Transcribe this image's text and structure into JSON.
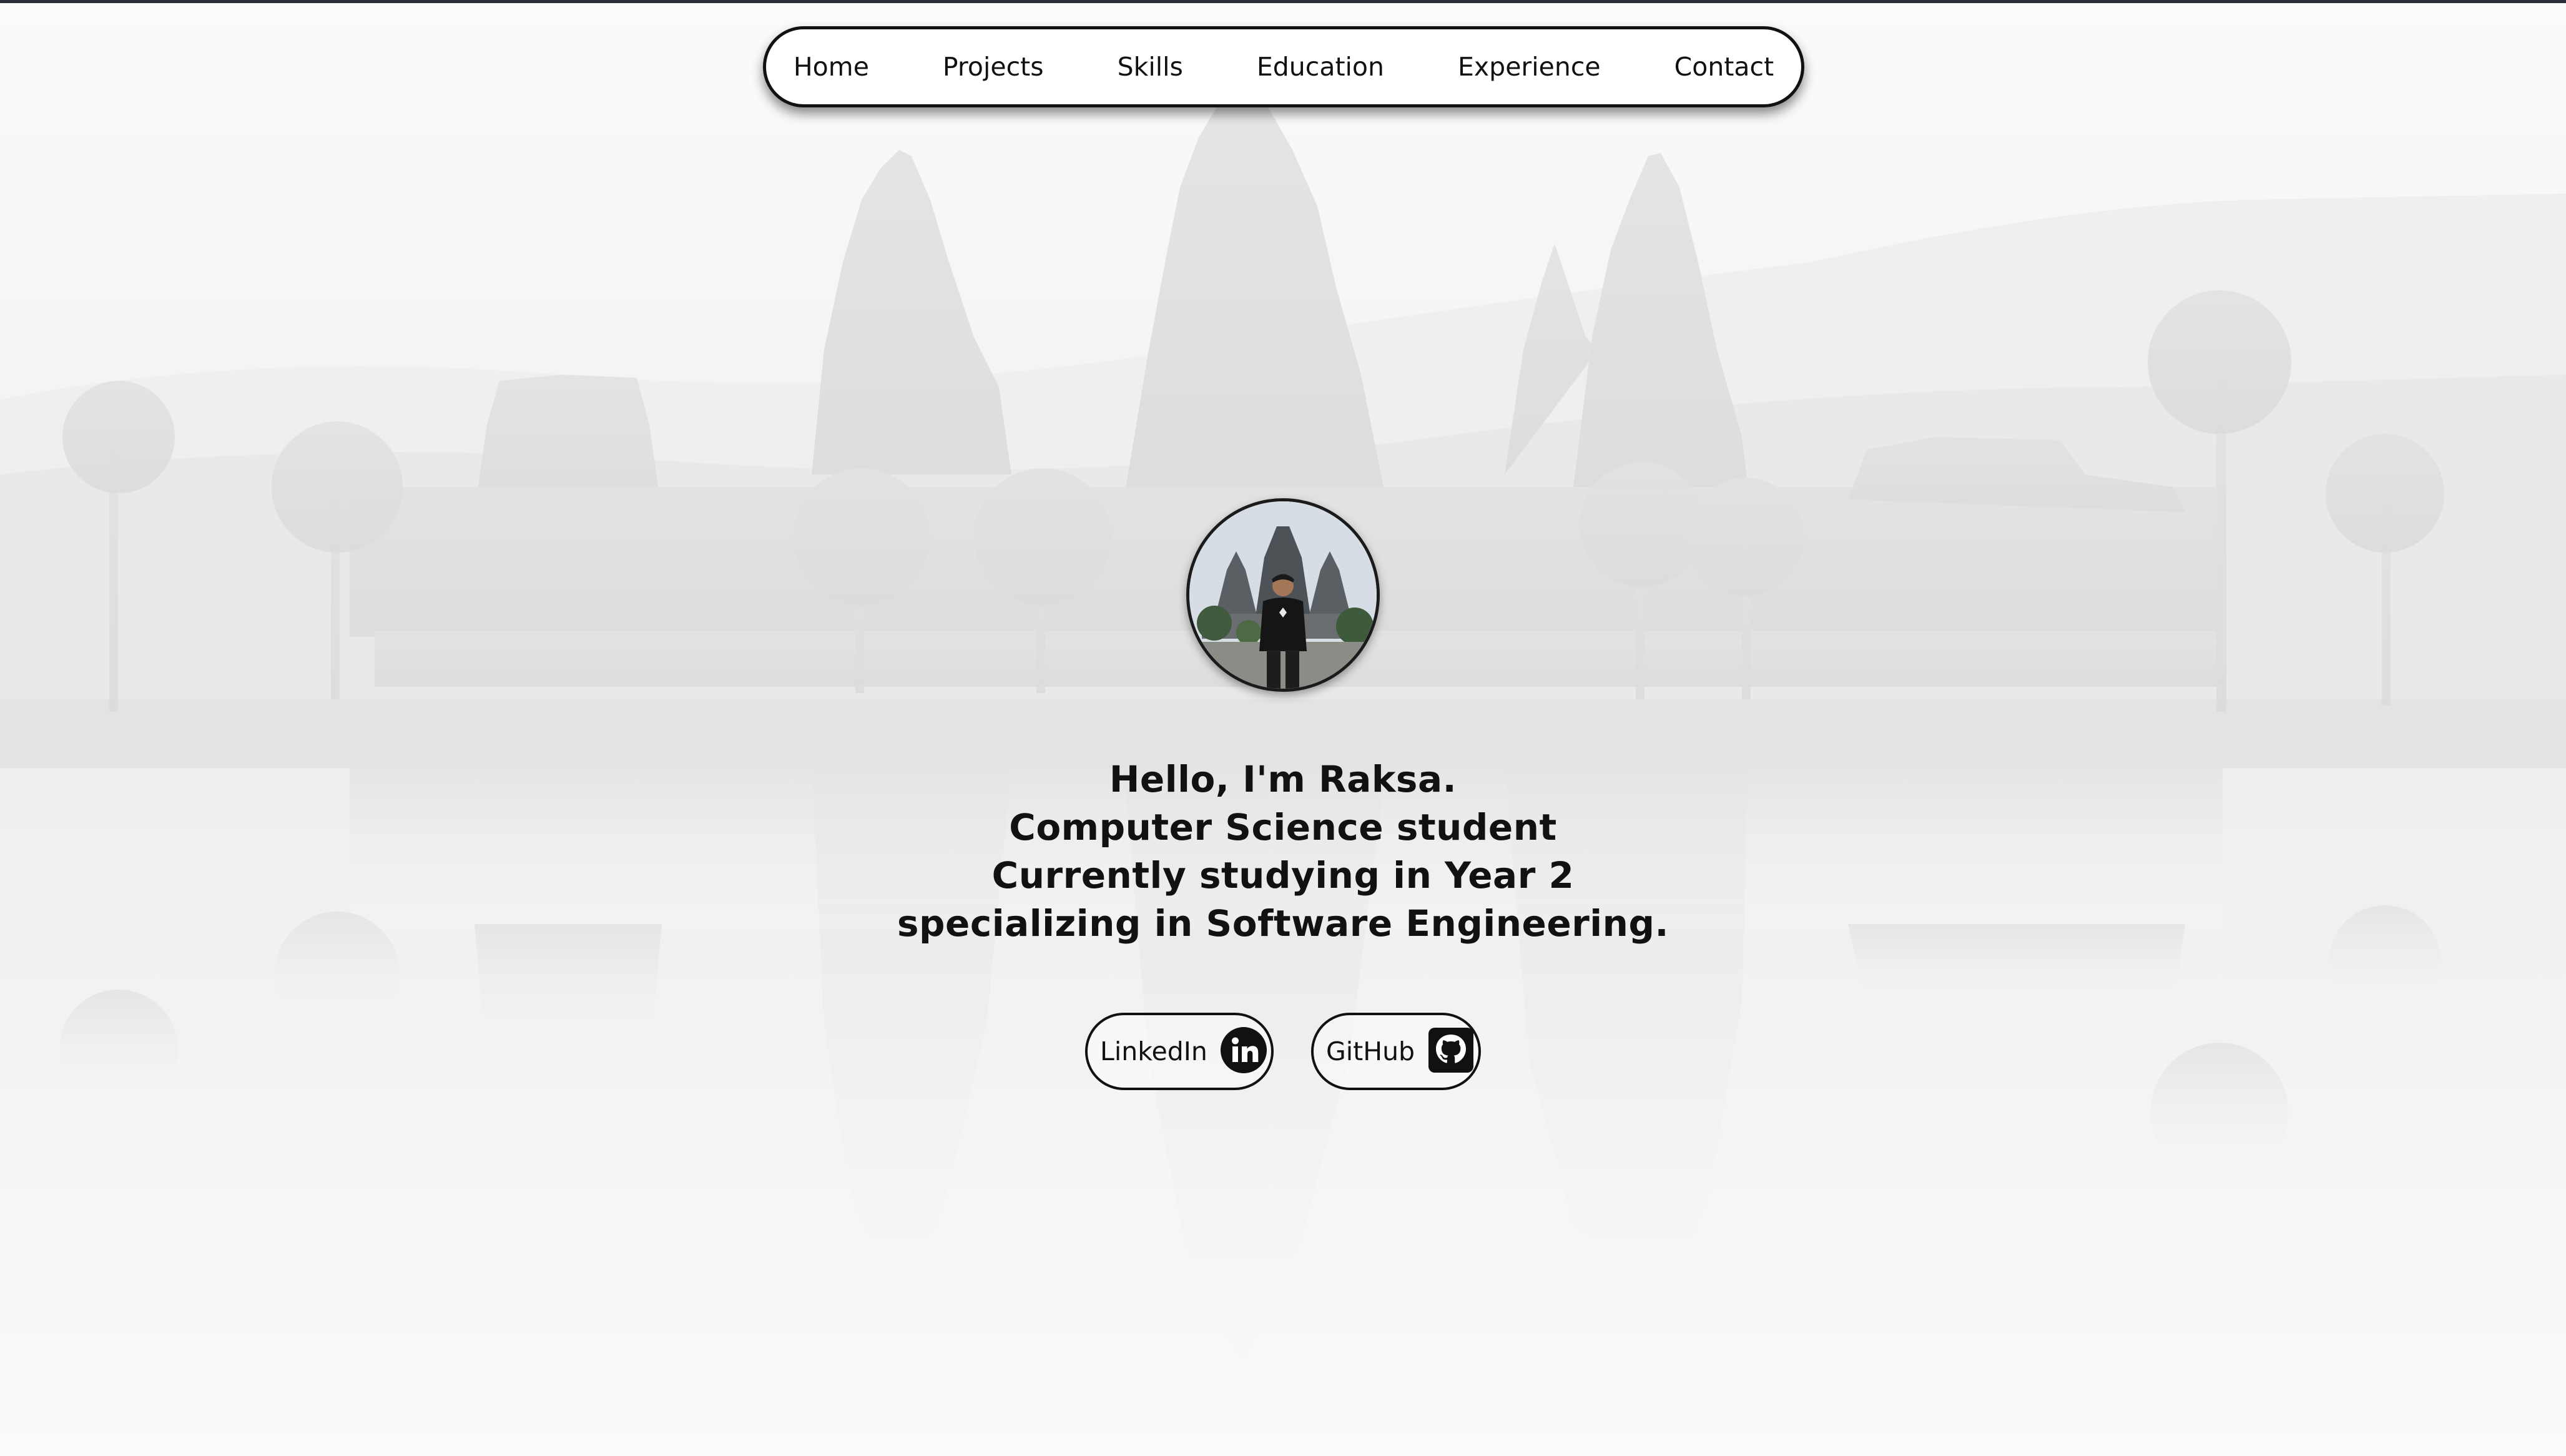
{
  "nav": {
    "items": [
      {
        "label": "Home"
      },
      {
        "label": "Projects"
      },
      {
        "label": "Skills"
      },
      {
        "label": "Education"
      },
      {
        "label": "Experience"
      },
      {
        "label": "Contact"
      }
    ]
  },
  "hero": {
    "lines": [
      "Hello, I'm Raksa.",
      "Computer Science student",
      "Currently studying in Year 2",
      "specializing in Software Engineering."
    ]
  },
  "social": {
    "linkedin": {
      "label": "LinkedIn",
      "icon": "linkedin-icon"
    },
    "github": {
      "label": "GitHub",
      "icon": "github-icon"
    }
  },
  "colors": {
    "text": "#111111",
    "background": "#f3f3f3",
    "nav_bg": "#ffffff",
    "scenery": "#dedede"
  }
}
